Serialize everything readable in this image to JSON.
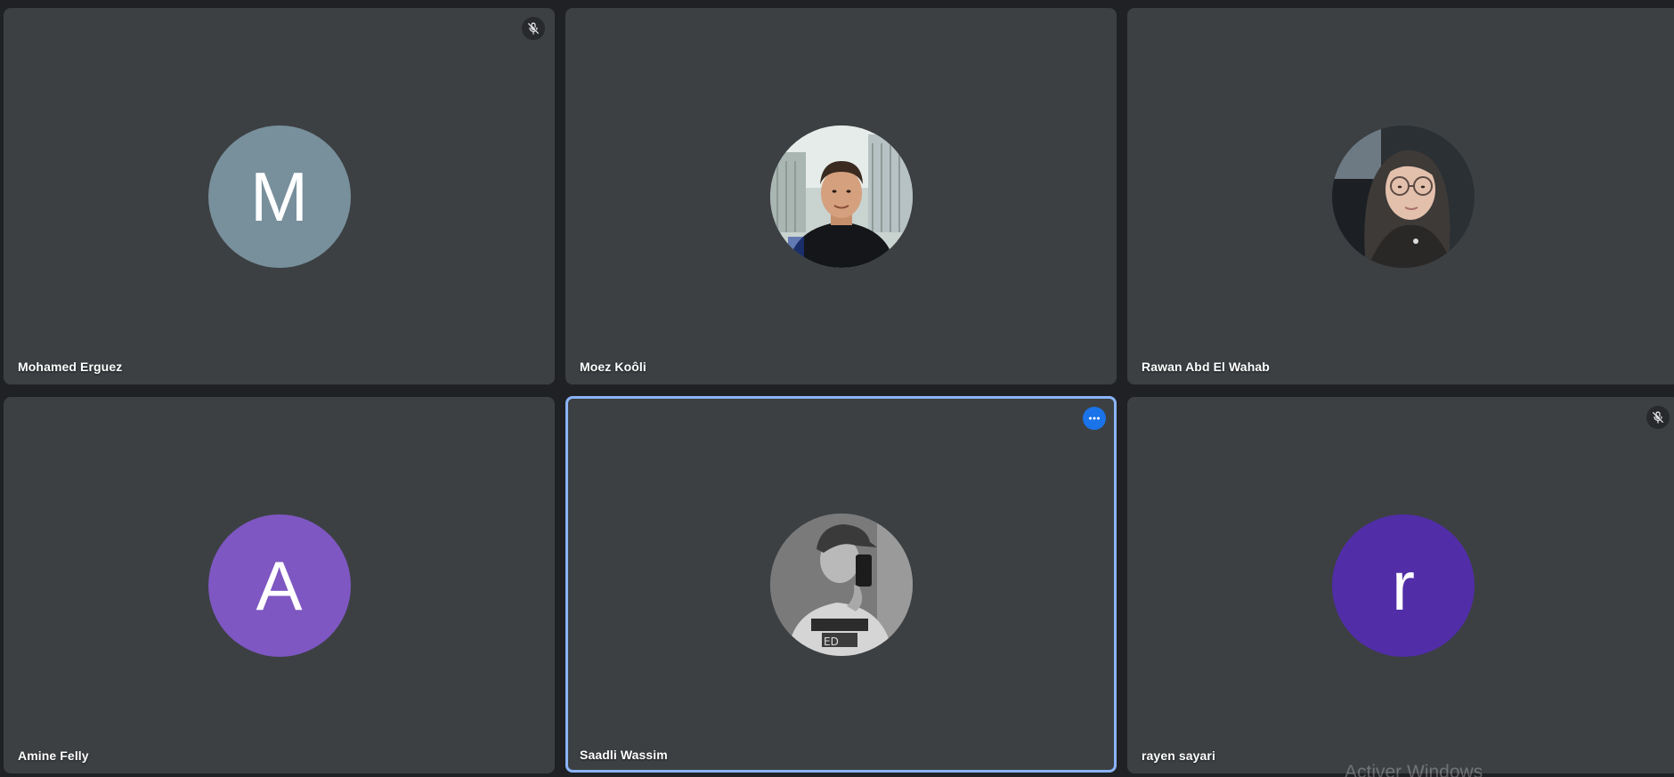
{
  "participants": [
    {
      "name": "Mohamed Erguez",
      "avatar_type": "letter",
      "avatar_letter": "M",
      "avatar_color": "#78909c",
      "muted": true,
      "active": false
    },
    {
      "name": "Moez Koôli",
      "avatar_type": "photo",
      "avatar_icon": "person-photo",
      "muted": false,
      "active": false
    },
    {
      "name": "Rawan Abd El Wahab",
      "avatar_type": "photo",
      "avatar_icon": "person-photo",
      "muted": false,
      "active": false
    },
    {
      "name": "Amine Felly",
      "avatar_type": "letter",
      "avatar_letter": "A",
      "avatar_color": "#7e57c2",
      "muted": false,
      "active": false
    },
    {
      "name": "Saadli Wassim",
      "avatar_type": "photo",
      "avatar_icon": "person-photo",
      "muted": false,
      "active": true,
      "more_options_icon": "more-horizontal-icon"
    },
    {
      "name": "rayen sayari",
      "avatar_type": "letter",
      "avatar_letter": "r",
      "avatar_color": "#512da8",
      "muted": true,
      "active": false
    }
  ],
  "colors": {
    "background": "#202124",
    "tile": "#3c4043",
    "active_border": "#8ab4f8",
    "more_button": "#1a73e8"
  },
  "watermark": "Activer Windows"
}
